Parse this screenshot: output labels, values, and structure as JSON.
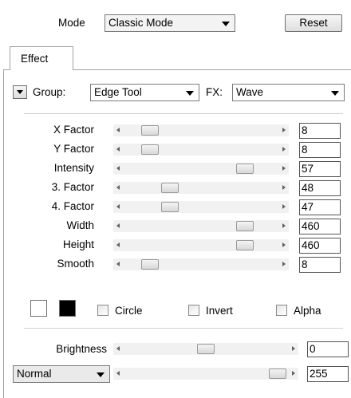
{
  "header": {
    "mode_label": "Mode",
    "mode_value": "Classic Mode",
    "reset_label": "Reset"
  },
  "tabs": [
    {
      "label": "Effect"
    }
  ],
  "effect": {
    "group_label": "Group:",
    "group_value": "Edge Tool",
    "fx_label": "FX:",
    "fx_value": "Wave"
  },
  "params": [
    {
      "label": "X Factor",
      "value": "8",
      "level": 0.12
    },
    {
      "label": "Y Factor",
      "value": "8",
      "level": 0.12
    },
    {
      "label": "Intensity",
      "value": "57",
      "level": 0.83
    },
    {
      "label": "3. Factor",
      "value": "48",
      "level": 0.27
    },
    {
      "label": "4. Factor",
      "value": "47",
      "level": 0.27
    },
    {
      "label": "Width",
      "value": "460",
      "level": 0.83
    },
    {
      "label": "Height",
      "value": "460",
      "level": 0.83
    },
    {
      "label": "Smooth",
      "value": "8",
      "level": 0.12
    }
  ],
  "colors": {
    "primary": "#ffffff",
    "secondary": "#000000"
  },
  "options": [
    {
      "label": "Circle",
      "checked": false
    },
    {
      "label": "Invert",
      "checked": false
    },
    {
      "label": "Alpha",
      "checked": false
    }
  ],
  "brightness": {
    "label": "Brightness",
    "value": "0",
    "level": 0.5
  },
  "blend": {
    "mode_value": "Normal",
    "value": "255",
    "level": 1.0
  }
}
